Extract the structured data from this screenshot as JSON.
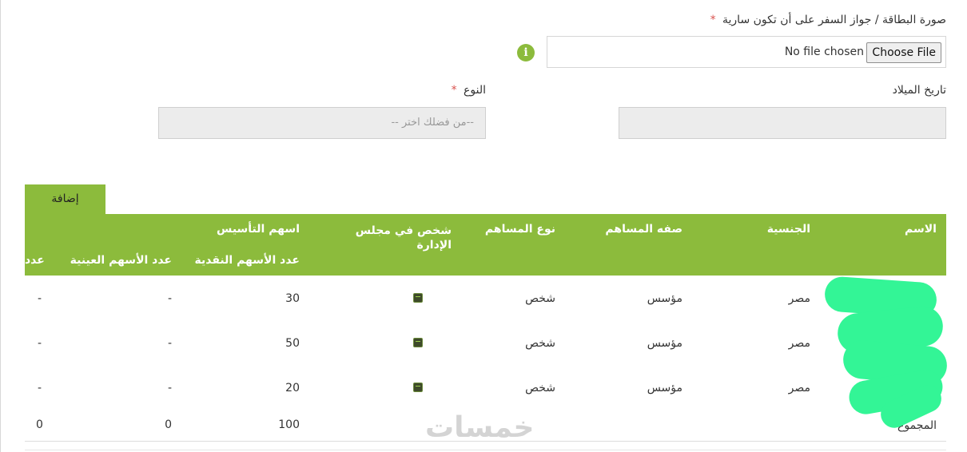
{
  "form": {
    "id_upload": {
      "label": "صورة البطاقة / جواز السفر على أن تكون سارية",
      "required_mark": "*",
      "button_label": "Choose File",
      "status_text": "No file chosen",
      "info_icon": "info-icon",
      "info_glyph": "i"
    },
    "birth_date": {
      "label": "تاريخ الميلاد",
      "value": ""
    },
    "gender": {
      "label": "النوع",
      "required_mark": "*",
      "placeholder": "--من فضلك اختر --"
    },
    "add_button_label": "إضافة"
  },
  "table": {
    "headers": {
      "name": "الاسم",
      "nationality": "الجنسية",
      "shareholder_capacity": "صفه المساهم",
      "shareholder_type": "نوع المساهم",
      "board_member": "شخص في مجلس الإدارة",
      "founding_shares": "اسهم التأسيس",
      "cash_shares": "عدد الأسهم النقدية",
      "inkind_shares": "عدد الأسهم العينية",
      "truncated": "عدد"
    },
    "rows": [
      {
        "nationality": "مصر",
        "capacity": "مؤسس",
        "type": "شخص",
        "board_member": true,
        "cash_shares": "30",
        "inkind_shares": "-",
        "last": "-"
      },
      {
        "nationality": "مصر",
        "capacity": "مؤسس",
        "type": "شخص",
        "board_member": true,
        "cash_shares": "50",
        "inkind_shares": "-",
        "last": "-"
      },
      {
        "nationality": "مصر",
        "capacity": "مؤسس",
        "type": "شخص",
        "board_member": true,
        "cash_shares": "20",
        "inkind_shares": "-",
        "last": "-"
      }
    ],
    "total": {
      "label": "المجموع",
      "cash_shares": "100",
      "inkind_shares": "0",
      "last": "0"
    }
  },
  "watermark": "خمسات",
  "colors": {
    "accent": "#8cbb3c",
    "required": "#d9534f",
    "redaction": "#33f596"
  }
}
